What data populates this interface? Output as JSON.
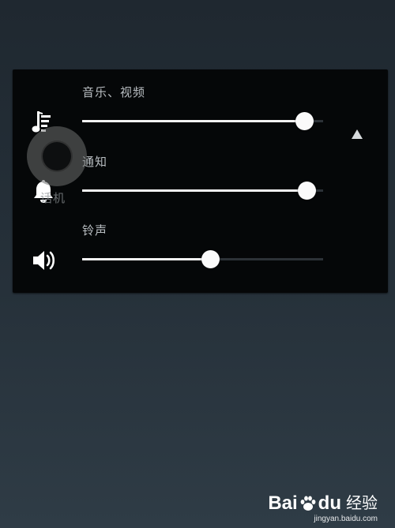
{
  "volume_panel": {
    "rows": [
      {
        "label": "音乐、视频",
        "icon": "music-note-icon",
        "level": 0.92
      },
      {
        "label": "通知",
        "icon": "bell-icon",
        "level": 0.93
      },
      {
        "label": "铃声",
        "icon": "speaker-icon",
        "level": 0.53
      }
    ],
    "expand_icon": "triangle-up-icon"
  },
  "overlay": {
    "assistive_touch_icon": "assistive-touch-icon",
    "label": "话机"
  },
  "watermark": {
    "logo_bai": "Bai",
    "logo_du": "du",
    "logo_jingyan": "经验",
    "url": "jingyan.baidu.com"
  },
  "colors": {
    "background": "#26313a",
    "panel": "#050708",
    "slider_fill": "#f4f4f4",
    "slider_track": "#2c3237",
    "thumb": "#fafafa",
    "label": "#b9bec2"
  }
}
